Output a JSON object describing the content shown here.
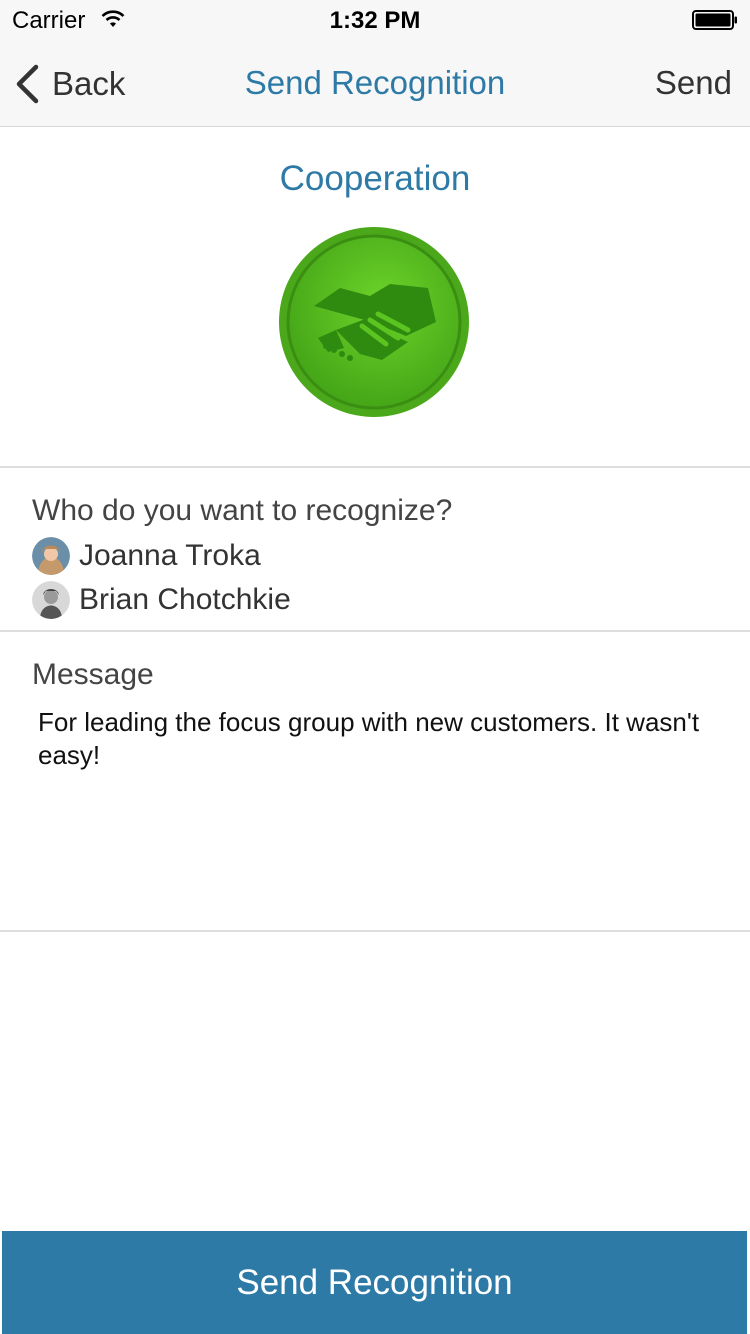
{
  "status": {
    "carrier": "Carrier",
    "time": "1:32 PM",
    "wifi_icon": "wifi-icon",
    "battery_icon": "battery-icon"
  },
  "nav": {
    "back_label": "Back",
    "title": "Send Recognition",
    "send_label": "Send"
  },
  "award": {
    "name": "Cooperation",
    "icon": "handshake-icon",
    "badge_color": "#5cbf24"
  },
  "recipients": {
    "prompt": "Who do you want to recognize?",
    "people": [
      {
        "name": "Joanna Troka"
      },
      {
        "name": "Brian Chotchkie"
      }
    ]
  },
  "message": {
    "label": "Message",
    "text": "For leading the focus group with new customers. It wasn't easy!"
  },
  "footer": {
    "button_label": "Send Recognition"
  },
  "colors": {
    "accent": "#2e7aa6",
    "bar_bg": "#f7f7f7",
    "divider": "#dedede"
  }
}
